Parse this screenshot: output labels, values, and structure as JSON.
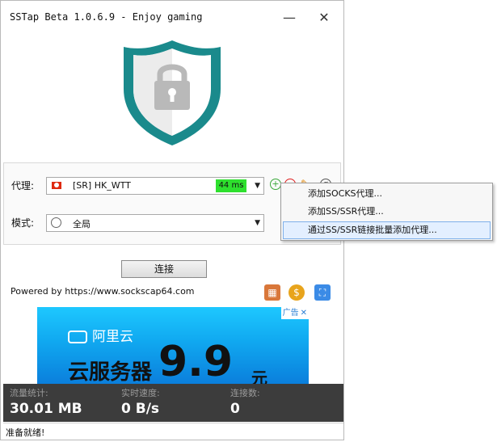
{
  "window": {
    "title": "SSTap Beta 1.0.6.9 - Enjoy gaming",
    "minimize_glyph": "—",
    "close_glyph": "✕"
  },
  "proxy": {
    "label": "代理:",
    "selected": "[SR] HK_WTT",
    "latency": "44 ms",
    "latency_color": "#2ee02e"
  },
  "mode": {
    "label": "模式:",
    "selected": "全局"
  },
  "icons": {
    "add": "add-proxy-icon",
    "remove": "remove-proxy-icon",
    "edit": "edit-proxy-icon",
    "test": "test-latency-icon"
  },
  "context_menu": {
    "items": [
      {
        "label": "添加SOCKS代理..."
      },
      {
        "label": "添加SS/SSR代理..."
      },
      {
        "label": "通过SS/SSR链接批量添加代理...",
        "highlighted": true
      }
    ]
  },
  "connect_button": "连接",
  "powered_by": "Powered by https://www.sockscap64.com",
  "ad": {
    "tag": "广告",
    "close": "✕",
    "brand": "阿里云",
    "headline": "云服务器",
    "price": "9.9",
    "unit": "元"
  },
  "stats": {
    "traffic_label": "流量统计:",
    "traffic_value": "30.01 MB",
    "speed_label": "实时速度:",
    "speed_value": "0 B/s",
    "connections_label": "连接数:",
    "connections_value": "0"
  },
  "status": "准备就绪!",
  "colors": {
    "shield_outer": "#1a8a8c",
    "shield_inner": "#ffffff",
    "lock": "#b9b9b9",
    "stats_bg": "#3c3c3c",
    "ad_blue": "#10a8f0"
  }
}
